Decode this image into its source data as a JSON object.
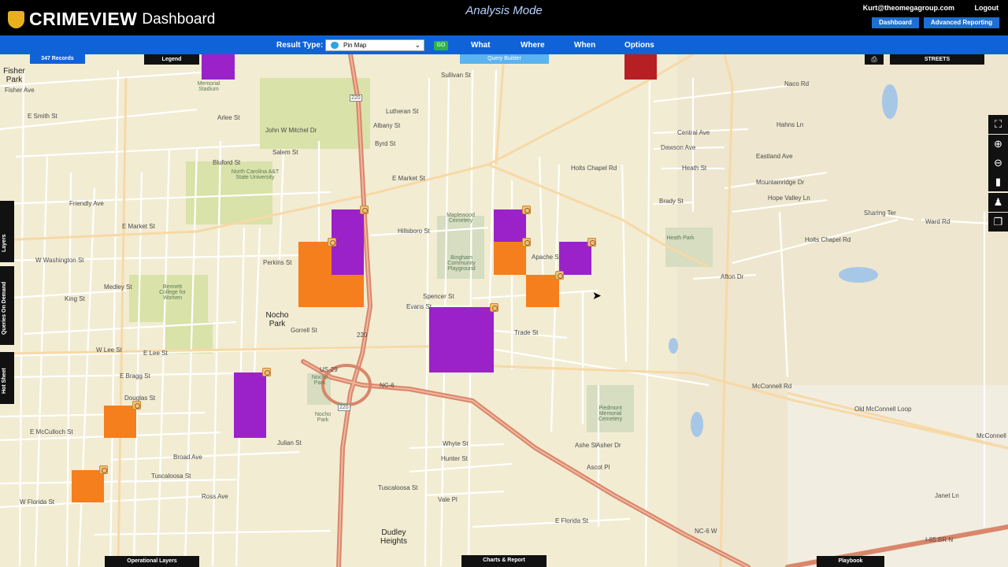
{
  "header": {
    "logo_brand": "CRIMEVIEW",
    "logo_sub": "Dashboard",
    "mode": "Analysis Mode",
    "user_email": "Kurt@theomegagroup.com",
    "logout": "Logout",
    "dashboard_button": "Dashboard",
    "advanced_button": "Advanced Reporting"
  },
  "toolbar": {
    "result_type_label": "Result Type:",
    "result_type_value": "Pin Map",
    "go": "GO",
    "menu": [
      "What",
      "Where",
      "When",
      "Options"
    ]
  },
  "map_overlay": {
    "records": "347 Records",
    "legend": "Legend",
    "query_builder": "Query Builder",
    "streets": "STREETS",
    "operational_layers": "Operational Layers",
    "charts_report": "Charts & Report",
    "playbook": "Playbook",
    "side_tabs": [
      "Layers",
      "Queries On Demand",
      "Hot Sheet"
    ]
  },
  "map_labels": {
    "places": [
      "Fisher Park",
      "Nocho Park",
      "Dudley Heights"
    ],
    "greens": [
      "Memorial Stadium",
      "North Carolina A&T State University",
      "Maplewood Cemetery",
      "Bingham Community Playground",
      "Bennett College for Women",
      "Heath Park",
      "Nocho Park",
      "Piedmont Memorial Cemetery",
      "Nocho Park"
    ],
    "streets_h": [
      "Fisher Ave",
      "E Smith St",
      "Sullivan St",
      "Lutheran St",
      "Arlee St",
      "John W Mitchel Dr",
      "Albany St",
      "Salem St",
      "Byrd St",
      "Bluford St",
      "E Market St",
      "Holts Chapel Rd",
      "Friendly Ave",
      "E Market St",
      "Hillsboro St",
      "W Washington St",
      "Perkins St",
      "Apache St",
      "Medley St",
      "King St",
      "Spencer St",
      "Evans St",
      "Gorrell St",
      "Trade St",
      "W Lee St",
      "E Lee St",
      "E Bragg St",
      "Douglas St",
      "E McCulloch St",
      "Julian St",
      "Broad Ave",
      "Tuscaloosa St",
      "Ross Ave",
      "Hunter St",
      "Whyte St",
      "Vale Pl",
      "E Florida St",
      "Tuscaloosa St",
      "W Florida St",
      "Ashe St",
      "Naco Rd",
      "Central Ave",
      "Dawson Ave",
      "Heath St",
      "Hahns Ln",
      "Eastland Ave",
      "Brady St",
      "Mountainridge Dr",
      "Hope Valley Ln",
      "Sharing Ter",
      "Ward Rd",
      "Holts Chapel Rd",
      "Afton Dr",
      "McConnell Rd",
      "Old McConnell Loop",
      "McConnell Rd",
      "Asher Dr",
      "Janet Ln",
      "Ascot Pl"
    ],
    "highway_labels": [
      "220",
      "220",
      "220",
      "US-29",
      "NC-6",
      "I-85 BR N",
      "NC-6 W"
    ]
  },
  "colors": {
    "purple": "#9a22c8",
    "orange": "#f57e1d",
    "red": "#b61f24",
    "accent": "#1063d6"
  },
  "icons": [
    "shield-icon",
    "print-icon",
    "fullscreen-icon",
    "zoom-in-icon",
    "zoom-out-icon",
    "tool-icon",
    "person-icon",
    "layers-icon",
    "dropdown-caret-icon",
    "pin-icon",
    "incident-icon",
    "cursor-icon"
  ]
}
